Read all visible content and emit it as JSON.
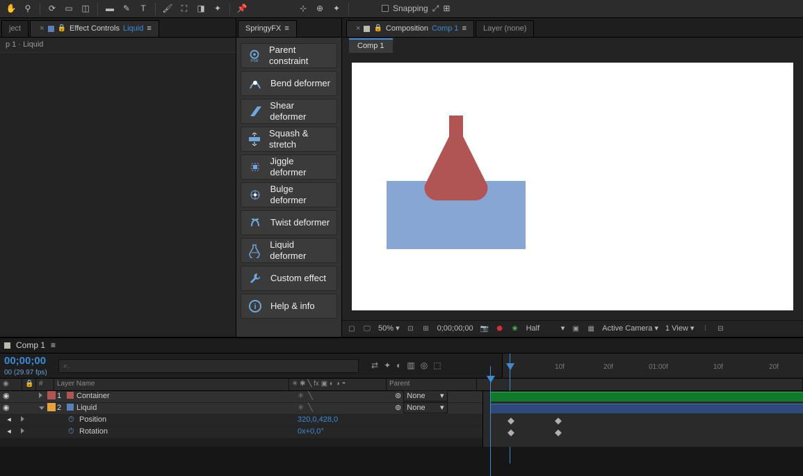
{
  "toolbar": {
    "snapping_label": "Snapping"
  },
  "left_panel": {
    "project_tab": "ject",
    "fx_tab_prefix": "Effect Controls",
    "fx_tab_link": "Liquid",
    "breadcrumb": "p 1 · Liquid"
  },
  "springy": {
    "title": "SpringyFX",
    "items": [
      {
        "label": "Parent constraint"
      },
      {
        "label": "Bend deformer"
      },
      {
        "label": "Shear deformer"
      },
      {
        "label": "Squash & stretch"
      },
      {
        "label": "Jiggle deformer"
      },
      {
        "label": "Bulge deformer"
      },
      {
        "label": "Twist deformer"
      },
      {
        "label": "Liquid deformer"
      },
      {
        "label": "Custom effect"
      },
      {
        "label": "Help & info"
      }
    ]
  },
  "composition": {
    "tab_prefix": "Composition",
    "tab_link": "Comp 1",
    "layer_tab": "Layer (none)",
    "subtab": "Comp 1"
  },
  "viewer_footer": {
    "zoom": "50%",
    "time": "0;00;00;00",
    "resolution": "Half",
    "camera": "Active Camera",
    "views": "1 View"
  },
  "timeline": {
    "tab": "Comp 1",
    "time": "00;00;00",
    "fps": "00 (29.97 fps)",
    "search_placeholder": "⌕.",
    "columns": {
      "num": "#",
      "layer_name": "Layer Name",
      "switches": "✳ ✱ ╲ fx ▣ ◐ ◑ ◓",
      "parent": "Parent"
    },
    "ruler": [
      "f",
      "10f",
      "20f",
      "01:00f",
      "10f",
      "20f"
    ],
    "layers": [
      {
        "index": "1",
        "name": "Container",
        "color": "#b05553",
        "parent": "None"
      },
      {
        "index": "2",
        "name": "Liquid",
        "color": "#5b7fb8",
        "parent": "None"
      }
    ],
    "props": [
      {
        "name": "Position",
        "value": "320,0,428,0"
      },
      {
        "name": "Rotation",
        "value": "0x+0,0°"
      }
    ]
  }
}
